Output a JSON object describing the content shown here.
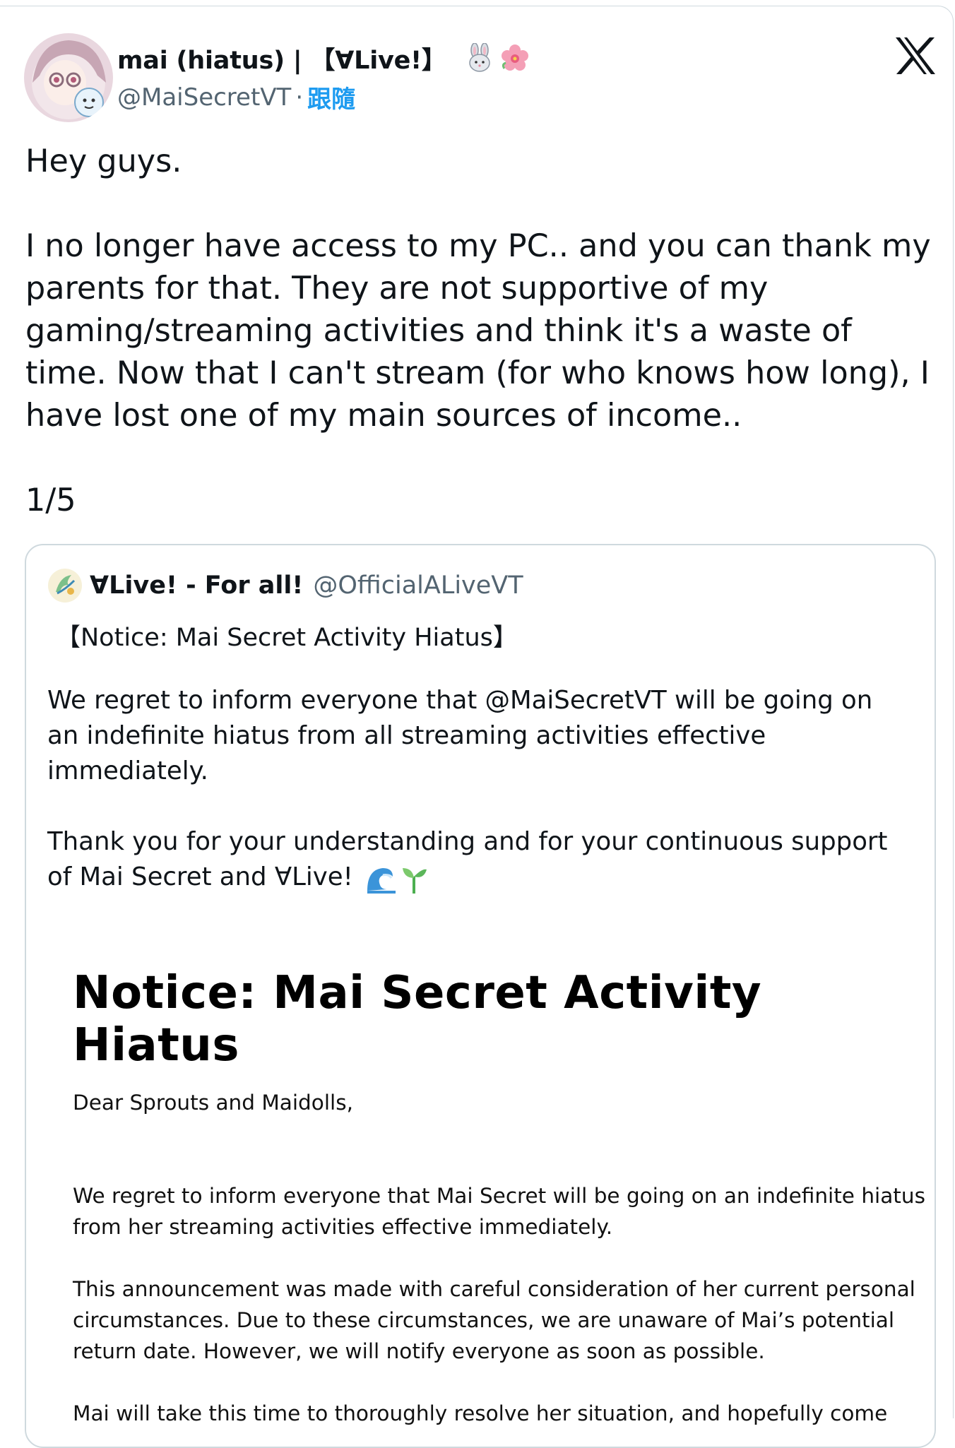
{
  "author": {
    "display_name": "mai (hiatus) | 【∀Live!】",
    "handle": "@MaiSecretVT",
    "separator": "·",
    "follow_label": "跟隨",
    "name_emojis": [
      "rabbit-icon",
      "flower-icon"
    ]
  },
  "platform": {
    "logo": "x-logo-icon"
  },
  "tweet": {
    "text": "Hey guys.\n\nI no longer have access to my PC.. and you can thank my parents for that. They are not supportive of my gaming/streaming activities and think it's a waste of time. Now that I can't stream (for who knows how long), I have lost one of my main sources of income..\n\n1/5"
  },
  "quote": {
    "display_name": "∀Live! - For all!",
    "handle": "@OfficialALiveVT",
    "title": "【Notice: Mai Secret Activity Hiatus】",
    "text": "We regret to inform everyone that @MaiSecretVT will be going on an indefinite hiatus from all streaming activities effective immediately.\n\nThank you for your understanding and for your continuous support of Mai Secret and ∀Live!",
    "text_emojis": [
      "wave-icon",
      "seedling-icon"
    ]
  },
  "notice_image": {
    "title": "Notice: Mai Secret Activity Hiatus",
    "body": "Dear Sprouts and Maidolls,\n\n\nWe regret to inform everyone that Mai Secret will be going on an indefinite hiatus from her streaming activities effective immediately.\n\nThis announcement was made with careful consideration of her current personal circumstances. Due to these circumstances, we are unaware of Mai’s potential return date. However, we will notify everyone as soon as possible.\n\nMai will take this time to thoroughly resolve her situation, and hopefully come"
  },
  "colors": {
    "text": "#0f1419",
    "secondary": "#536471",
    "link": "#1d9bf0",
    "border": "#cfd9de"
  }
}
